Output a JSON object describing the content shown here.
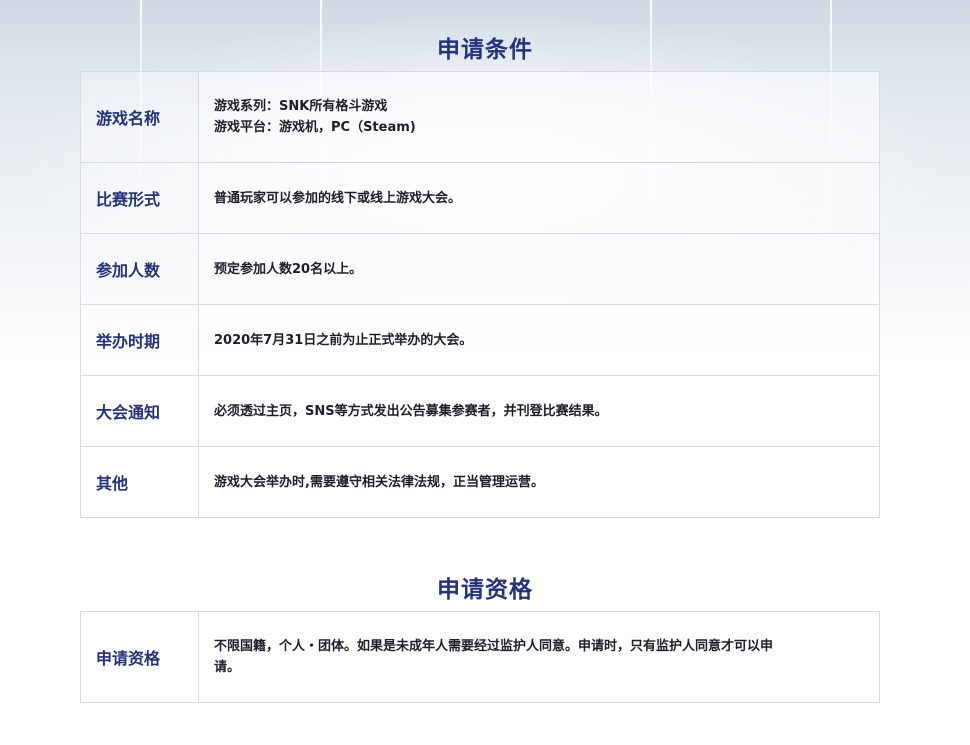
{
  "conditions": {
    "title": "申请条件",
    "rows": [
      {
        "label": "游戏名称",
        "lines": [
          "游戏系列：SNK所有格斗游戏",
          "游戏平台：游戏机，PC（Steam)"
        ]
      },
      {
        "label": "比赛形式",
        "lines": [
          "普通玩家可以参加的线下或线上游戏大会。"
        ]
      },
      {
        "label": "参加人数",
        "lines": [
          "预定参加人数20名以上。"
        ]
      },
      {
        "label": "举办时期",
        "lines": [
          "2020年7月31日之前为止正式举办的大会。"
        ]
      },
      {
        "label": "大会通知",
        "lines": [
          "必须透过主页，SNS等方式发出公告募集参赛者，并刊登比赛结果。"
        ]
      },
      {
        "label": "其他",
        "lines": [
          "游戏大会举办时,需要遵守相关法律法规，正当管理运营。"
        ]
      }
    ]
  },
  "qualification": {
    "title": "申请资格",
    "rows": [
      {
        "label": "申请资格",
        "lines": [
          "不限国籍，个人・团体。如果是未成年人需要经过监护人同意。申请时，只有监护人同意才可以申",
          "请。"
        ]
      }
    ]
  },
  "colors": {
    "title": "#24327a",
    "label": "#24327a",
    "text": "#1e1e28",
    "border": "#d7dbe1"
  }
}
